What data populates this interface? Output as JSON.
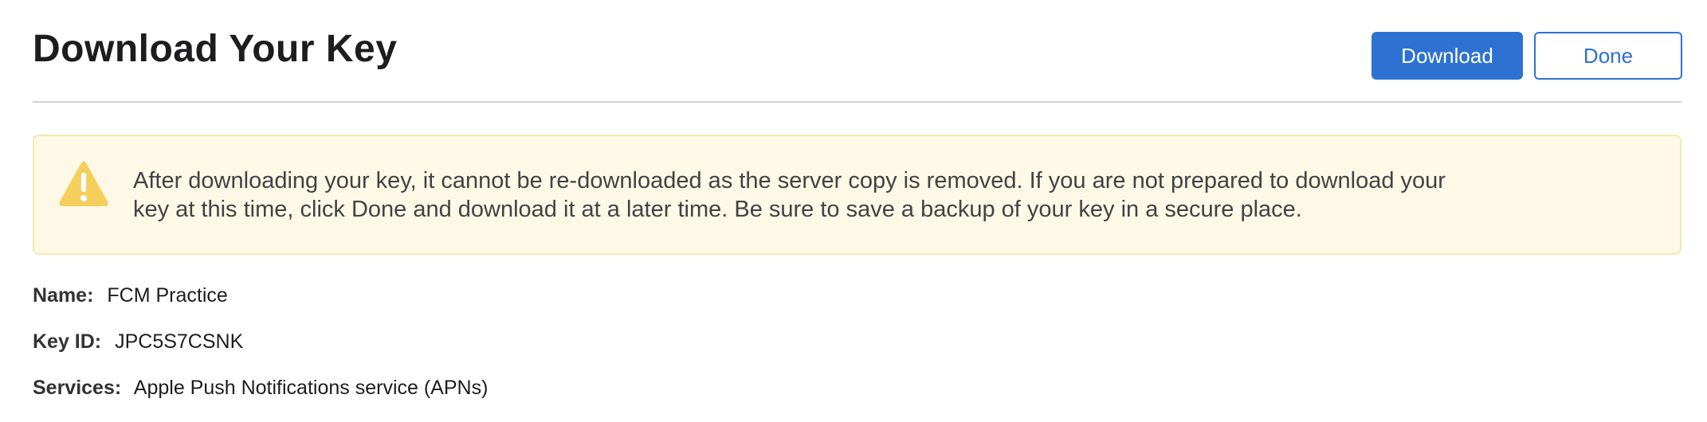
{
  "header": {
    "title": "Download Your Key",
    "download_label": "Download",
    "done_label": "Done"
  },
  "alert": {
    "icon": "warning-icon",
    "text": "After downloading your key, it cannot be re-downloaded as the server copy is removed. If you are not prepared to download your key at this time, click Done and download it at a later time. Be sure to save a backup of your key in a secure place."
  },
  "details": {
    "name_label": "Name:",
    "name_value": "FCM Practice",
    "keyid_label": "Key ID:",
    "keyid_value": "JPC5S7CSNK",
    "services_label": "Services:",
    "services_value": "Apple Push Notifications service (APNs)"
  },
  "colors": {
    "accent": "#2d72d2",
    "alert_bg": "#fef9e7",
    "alert_border": "#f7e7b0",
    "warning_icon": "#f4cf5c"
  }
}
